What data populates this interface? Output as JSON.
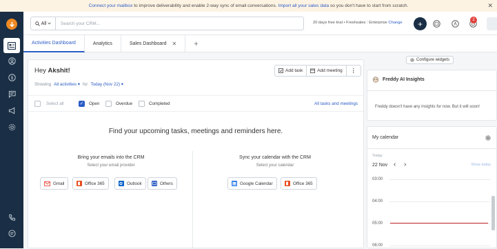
{
  "banner": {
    "link1": "Connect your mailbox",
    "text1": " to improve deliverability and enable 2-way sync of email conversations. ",
    "link2": "Import all your sales data",
    "text2": " so you don't have to start from scratch.",
    "close": "✕"
  },
  "topbar": {
    "scope": "All",
    "search_placeholder": "Search your CRM...",
    "trial_text": "20 days free trial • Freshsales : Enterprise",
    "trial_change": "Change",
    "notif_count": "2"
  },
  "tabs": [
    {
      "label": "Activities Dashboard"
    },
    {
      "label": "Analytics"
    },
    {
      "label": "Sales Dashboard"
    }
  ],
  "main": {
    "greeting": "Hey",
    "user": "Akshit!",
    "add_task": "Add task",
    "add_meeting": "Add meeting",
    "more": "⋮",
    "showing_label": "Showing",
    "activities_filter": "All activities",
    "for_label": "for",
    "date_filter": "Today (Nov 22)",
    "filters": {
      "select_all": "Select all",
      "open": "Open",
      "overdue": "Overdue",
      "completed": "Completed",
      "all_tasks": "All tasks and meetings"
    },
    "headline": "Find your upcoming tasks, meetings and reminders here.",
    "emails": {
      "title": "Bring your emails into the CRM",
      "subtitle": "Select your email provider",
      "providers": [
        "Gmail",
        "Office 365",
        "Outlook",
        "Others"
      ]
    },
    "calendar": {
      "title": "Sync your calendar with the CRM",
      "subtitle": "Select your calendar",
      "providers": [
        "Google Calendar",
        "Office 365"
      ]
    }
  },
  "right": {
    "configure": "Configure widgets",
    "freddy_title": "Freddy AI Insights",
    "freddy_msg": "Freddy doesn't have any insights for now. But it will soon!",
    "cal_title": "My calendar",
    "today": "Today",
    "date": "22 Nov",
    "show_today": "Show today",
    "slots": [
      "03:00",
      "04:00",
      "05:00",
      "06:00"
    ]
  },
  "colors": {
    "sidebar": "#1a2f45",
    "accent": "#2c5cc5",
    "logo": "#f08a24",
    "now_line": "#c72a2a"
  }
}
